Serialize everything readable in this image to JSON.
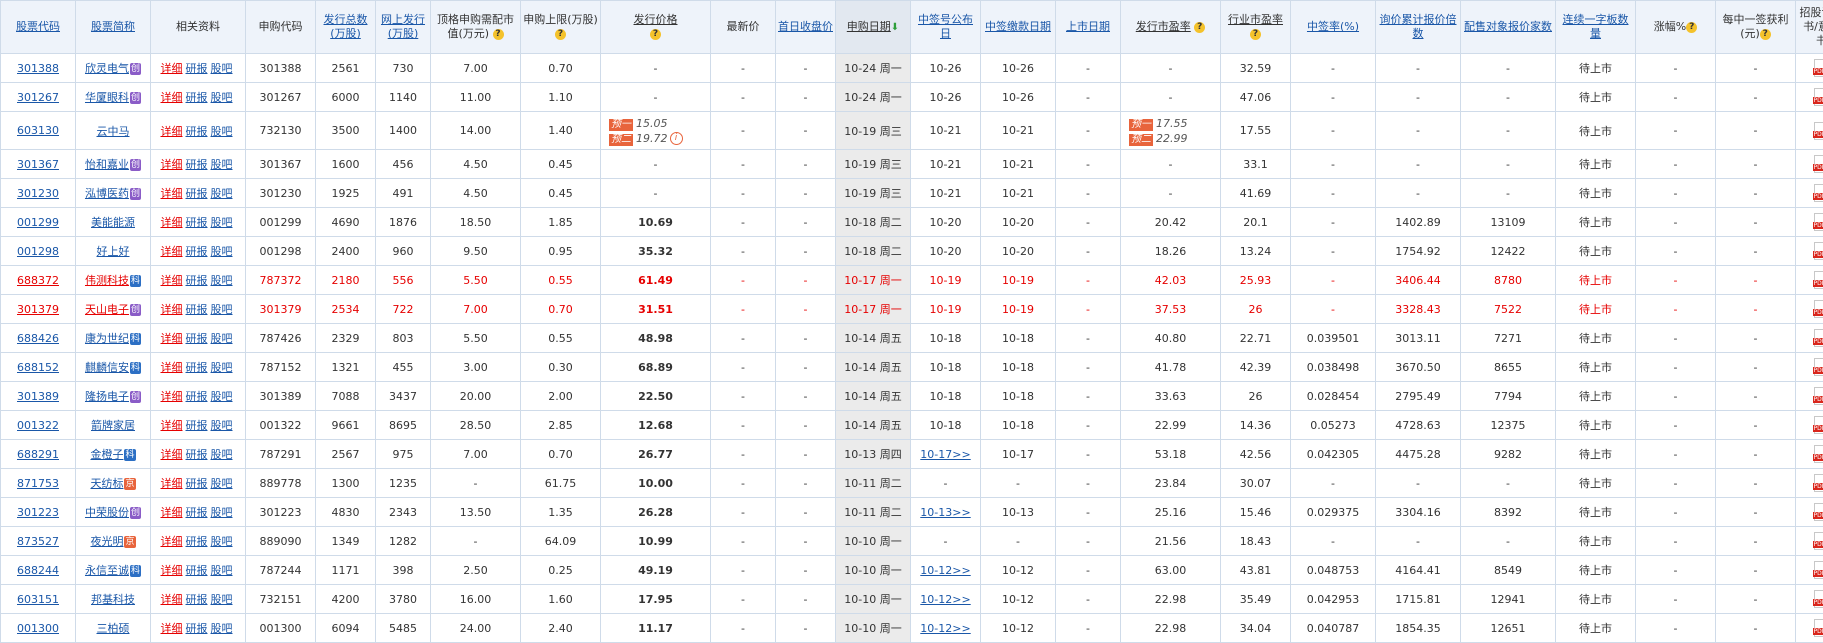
{
  "headers": {
    "code": "股票代码",
    "name": "股票简称",
    "related": "相关资料",
    "sub_code": "申购代码",
    "total_shares": "发行总数(万股)",
    "online_shares": "网上发行(万股)",
    "top_cap": "顶格申购需配市值(万元)",
    "limit": "申购上限(万股)",
    "price": "发行价格",
    "latest": "最新价",
    "first_close": "首日收盘价",
    "sub_date": "申购日期",
    "lot_date": "中签号公布日",
    "pay_date": "中签缴款日期",
    "list_date": "上市日期",
    "issue_pe": "发行市盈率",
    "ind_pe": "行业市盈率",
    "win_rate": "中签率(%)",
    "inquiry": "询价累计报价倍数",
    "alloc": "配售对象报价家数",
    "boards": "连续一字板数量",
    "change": "涨幅%",
    "profit": "每中一签获利(元)",
    "prospectus": "招股说明书/意向书"
  },
  "labels": {
    "detail": "详细",
    "research": "研报",
    "forum": "股吧",
    "pre1": "预一",
    "pre2": "预二",
    "question": "?",
    "info": "i",
    "sort_arrow": "⬇"
  },
  "rows": [
    {
      "code": "301388",
      "name": "欣灵电气",
      "board": "创",
      "sub_code": "301388",
      "total": "2561",
      "online": "730",
      "top": "7.00",
      "limit": "0.70",
      "price": "-",
      "latest": "-",
      "first": "-",
      "date": "10-24 周一",
      "lot": "10-26",
      "pay": "10-26",
      "list": "-",
      "ipe": "-",
      "ind": "32.59",
      "rate": "-",
      "inq": "-",
      "alloc": "-",
      "boards": "待上市",
      "chg": "-",
      "profit": "-",
      "red": false
    },
    {
      "code": "301267",
      "name": "华厦眼科",
      "board": "创",
      "sub_code": "301267",
      "total": "6000",
      "online": "1140",
      "top": "11.00",
      "limit": "1.10",
      "price": "-",
      "latest": "-",
      "first": "-",
      "date": "10-24 周一",
      "lot": "10-26",
      "pay": "10-26",
      "list": "-",
      "ipe": "-",
      "ind": "47.06",
      "rate": "-",
      "inq": "-",
      "alloc": "-",
      "boards": "待上市",
      "chg": "-",
      "profit": "-",
      "red": false
    },
    {
      "code": "603130",
      "name": "云中马",
      "board": "",
      "sub_code": "732130",
      "total": "3500",
      "online": "1400",
      "top": "14.00",
      "limit": "1.40",
      "price_pre1": "15.05",
      "price_pre2": "19.72",
      "latest": "-",
      "first": "-",
      "date": "10-19 周三",
      "lot": "10-21",
      "pay": "10-21",
      "list": "-",
      "ipe_pre1": "17.55",
      "ipe_pre2": "22.99",
      "ind": "17.55",
      "rate": "-",
      "inq": "-",
      "alloc": "-",
      "boards": "待上市",
      "chg": "-",
      "profit": "-",
      "red": false,
      "tall": true
    },
    {
      "code": "301367",
      "name": "怡和嘉业",
      "board": "创",
      "sub_code": "301367",
      "total": "1600",
      "online": "456",
      "top": "4.50",
      "limit": "0.45",
      "price": "-",
      "latest": "-",
      "first": "-",
      "date": "10-19 周三",
      "lot": "10-21",
      "pay": "10-21",
      "list": "-",
      "ipe": "-",
      "ind": "33.1",
      "rate": "-",
      "inq": "-",
      "alloc": "-",
      "boards": "待上市",
      "chg": "-",
      "profit": "-",
      "red": false
    },
    {
      "code": "301230",
      "name": "泓博医药",
      "board": "创",
      "sub_code": "301230",
      "total": "1925",
      "online": "491",
      "top": "4.50",
      "limit": "0.45",
      "price": "-",
      "latest": "-",
      "first": "-",
      "date": "10-19 周三",
      "lot": "10-21",
      "pay": "10-21",
      "list": "-",
      "ipe": "-",
      "ind": "41.69",
      "rate": "-",
      "inq": "-",
      "alloc": "-",
      "boards": "待上市",
      "chg": "-",
      "profit": "-",
      "red": false
    },
    {
      "code": "001299",
      "name": "美能能源",
      "board": "",
      "sub_code": "001299",
      "total": "4690",
      "online": "1876",
      "top": "18.50",
      "limit": "1.85",
      "price": "10.69",
      "latest": "-",
      "first": "-",
      "date": "10-18 周二",
      "lot": "10-20",
      "pay": "10-20",
      "list": "-",
      "ipe": "20.42",
      "ind": "20.1",
      "rate": "-",
      "inq": "1402.89",
      "alloc": "13109",
      "boards": "待上市",
      "chg": "-",
      "profit": "-",
      "red": false
    },
    {
      "code": "001298",
      "name": "好上好",
      "board": "",
      "sub_code": "001298",
      "total": "2400",
      "online": "960",
      "top": "9.50",
      "limit": "0.95",
      "price": "35.32",
      "latest": "-",
      "first": "-",
      "date": "10-18 周二",
      "lot": "10-20",
      "pay": "10-20",
      "list": "-",
      "ipe": "18.26",
      "ind": "13.24",
      "rate": "-",
      "inq": "1754.92",
      "alloc": "12422",
      "boards": "待上市",
      "chg": "-",
      "profit": "-",
      "red": false
    },
    {
      "code": "688372",
      "name": "伟测科技",
      "board": "科",
      "sub_code": "787372",
      "total": "2180",
      "online": "556",
      "top": "5.50",
      "limit": "0.55",
      "price": "61.49",
      "latest": "-",
      "first": "-",
      "date": "10-17 周一",
      "lot": "10-19",
      "pay": "10-19",
      "list": "-",
      "ipe": "42.03",
      "ind": "25.93",
      "rate": "-",
      "inq": "3406.44",
      "alloc": "8780",
      "boards": "待上市",
      "chg": "-",
      "profit": "-",
      "red": true
    },
    {
      "code": "301379",
      "name": "天山电子",
      "board": "创",
      "sub_code": "301379",
      "total": "2534",
      "online": "722",
      "top": "7.00",
      "limit": "0.70",
      "price": "31.51",
      "latest": "-",
      "first": "-",
      "date": "10-17 周一",
      "lot": "10-19",
      "pay": "10-19",
      "list": "-",
      "ipe": "37.53",
      "ind": "26",
      "rate": "-",
      "inq": "3328.43",
      "alloc": "7522",
      "boards": "待上市",
      "chg": "-",
      "profit": "-",
      "red": true
    },
    {
      "code": "688426",
      "name": "康为世纪",
      "board": "科",
      "sub_code": "787426",
      "total": "2329",
      "online": "803",
      "top": "5.50",
      "limit": "0.55",
      "price": "48.98",
      "latest": "-",
      "first": "-",
      "date": "10-14 周五",
      "lot": "10-18",
      "pay": "10-18",
      "list": "-",
      "ipe": "40.80",
      "ind": "22.71",
      "rate": "0.039501",
      "inq": "3013.11",
      "alloc": "7271",
      "boards": "待上市",
      "chg": "-",
      "profit": "-",
      "red": false
    },
    {
      "code": "688152",
      "name": "麒麟信安",
      "board": "科",
      "sub_code": "787152",
      "total": "1321",
      "online": "455",
      "top": "3.00",
      "limit": "0.30",
      "price": "68.89",
      "latest": "-",
      "first": "-",
      "date": "10-14 周五",
      "lot": "10-18",
      "pay": "10-18",
      "list": "-",
      "ipe": "41.78",
      "ind": "42.39",
      "rate": "0.038498",
      "inq": "3670.50",
      "alloc": "8655",
      "boards": "待上市",
      "chg": "-",
      "profit": "-",
      "red": false
    },
    {
      "code": "301389",
      "name": "隆扬电子",
      "board": "创",
      "sub_code": "301389",
      "total": "7088",
      "online": "3437",
      "top": "20.00",
      "limit": "2.00",
      "price": "22.50",
      "latest": "-",
      "first": "-",
      "date": "10-14 周五",
      "lot": "10-18",
      "pay": "10-18",
      "list": "-",
      "ipe": "33.63",
      "ind": "26",
      "rate": "0.028454",
      "inq": "2795.49",
      "alloc": "7794",
      "boards": "待上市",
      "chg": "-",
      "profit": "-",
      "red": false
    },
    {
      "code": "001322",
      "name": "箭牌家居",
      "board": "",
      "sub_code": "001322",
      "total": "9661",
      "online": "8695",
      "top": "28.50",
      "limit": "2.85",
      "price": "12.68",
      "latest": "-",
      "first": "-",
      "date": "10-14 周五",
      "lot": "10-18",
      "pay": "10-18",
      "list": "-",
      "ipe": "22.99",
      "ind": "14.36",
      "rate": "0.05273",
      "inq": "4728.63",
      "alloc": "12375",
      "boards": "待上市",
      "chg": "-",
      "profit": "-",
      "red": false
    },
    {
      "code": "688291",
      "name": "金橙子",
      "board": "科",
      "sub_code": "787291",
      "total": "2567",
      "online": "975",
      "top": "7.00",
      "limit": "0.70",
      "price": "26.77",
      "latest": "-",
      "first": "-",
      "date": "10-13 周四",
      "lot": "10-17>>",
      "lot_link": true,
      "pay": "10-17",
      "list": "-",
      "ipe": "53.18",
      "ind": "42.56",
      "rate": "0.042305",
      "inq": "4475.28",
      "alloc": "9282",
      "boards": "待上市",
      "chg": "-",
      "profit": "-",
      "red": false
    },
    {
      "code": "871753",
      "name": "天纺标",
      "board": "京",
      "sub_code": "889778",
      "total": "1300",
      "online": "1235",
      "top": "-",
      "limit": "61.75",
      "price": "10.00",
      "latest": "-",
      "first": "-",
      "date": "10-11 周二",
      "lot": "-",
      "pay": "-",
      "list": "-",
      "ipe": "23.84",
      "ind": "30.07",
      "rate": "-",
      "inq": "-",
      "alloc": "-",
      "boards": "待上市",
      "chg": "-",
      "profit": "-",
      "red": false
    },
    {
      "code": "301223",
      "name": "中荣股份",
      "board": "创",
      "sub_code": "301223",
      "total": "4830",
      "online": "2343",
      "top": "13.50",
      "limit": "1.35",
      "price": "26.28",
      "latest": "-",
      "first": "-",
      "date": "10-11 周二",
      "lot": "10-13>>",
      "lot_link": true,
      "pay": "10-13",
      "list": "-",
      "ipe": "25.16",
      "ind": "15.46",
      "rate": "0.029375",
      "inq": "3304.16",
      "alloc": "8392",
      "boards": "待上市",
      "chg": "-",
      "profit": "-",
      "red": false
    },
    {
      "code": "873527",
      "name": "夜光明",
      "board": "京",
      "sub_code": "889090",
      "total": "1349",
      "online": "1282",
      "top": "-",
      "limit": "64.09",
      "price": "10.99",
      "latest": "-",
      "first": "-",
      "date": "10-10 周一",
      "lot": "-",
      "pay": "-",
      "list": "-",
      "ipe": "21.56",
      "ind": "18.43",
      "rate": "-",
      "inq": "-",
      "alloc": "-",
      "boards": "待上市",
      "chg": "-",
      "profit": "-",
      "red": false
    },
    {
      "code": "688244",
      "name": "永信至诚",
      "board": "科",
      "sub_code": "787244",
      "total": "1171",
      "online": "398",
      "top": "2.50",
      "limit": "0.25",
      "price": "49.19",
      "latest": "-",
      "first": "-",
      "date": "10-10 周一",
      "lot": "10-12>>",
      "lot_link": true,
      "pay": "10-12",
      "list": "-",
      "ipe": "63.00",
      "ind": "43.81",
      "rate": "0.048753",
      "inq": "4164.41",
      "alloc": "8549",
      "boards": "待上市",
      "chg": "-",
      "profit": "-",
      "red": false
    },
    {
      "code": "603151",
      "name": "邦基科技",
      "board": "",
      "sub_code": "732151",
      "total": "4200",
      "online": "3780",
      "top": "16.00",
      "limit": "1.60",
      "price": "17.95",
      "latest": "-",
      "first": "-",
      "date": "10-10 周一",
      "lot": "10-12>>",
      "lot_link": true,
      "pay": "10-12",
      "list": "-",
      "ipe": "22.98",
      "ind": "35.49",
      "rate": "0.042953",
      "inq": "1715.81",
      "alloc": "12941",
      "boards": "待上市",
      "chg": "-",
      "profit": "-",
      "red": false
    },
    {
      "code": "001300",
      "name": "三柏硕",
      "board": "",
      "sub_code": "001300",
      "total": "6094",
      "online": "5485",
      "top": "24.00",
      "limit": "2.40",
      "price": "11.17",
      "latest": "-",
      "first": "-",
      "date": "10-10 周一",
      "lot": "10-12>>",
      "lot_link": true,
      "pay": "10-12",
      "list": "-",
      "ipe": "22.98",
      "ind": "34.04",
      "rate": "0.040787",
      "inq": "1854.35",
      "alloc": "12651",
      "boards": "待上市",
      "chg": "-",
      "profit": "-",
      "red": false
    }
  ]
}
